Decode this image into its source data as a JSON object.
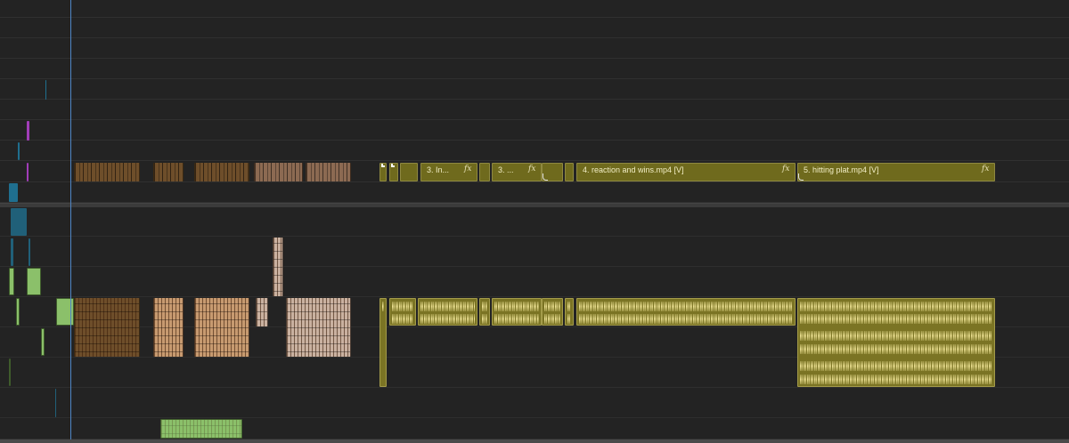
{
  "timeline": {
    "video_clips": [
      {
        "id": "v-clip-3a",
        "label": "3. In...",
        "fx": "fx"
      },
      {
        "id": "v-clip-3b",
        "label": "3. ...",
        "fx": "fx"
      },
      {
        "id": "v-clip-4",
        "label": "4. reaction and wins.mp4 [V]",
        "fx": "fx"
      },
      {
        "id": "v-clip-5",
        "label": "5. hitting plat.mp4 [V]",
        "fx": "fx"
      }
    ]
  },
  "colors": {
    "background": "#232323",
    "playhead": "#4f86c6",
    "video_clip_olive": "#6f6a1d",
    "audio_clip_olive": "#7b7424",
    "waveform": "#faeea0",
    "brown_clip": "#6e4e2a",
    "tan_clip": "#c79a70",
    "green_clip": "#8bc06a",
    "teal_clip": "#1f6f8f",
    "magenta_clip": "#a13db8"
  }
}
